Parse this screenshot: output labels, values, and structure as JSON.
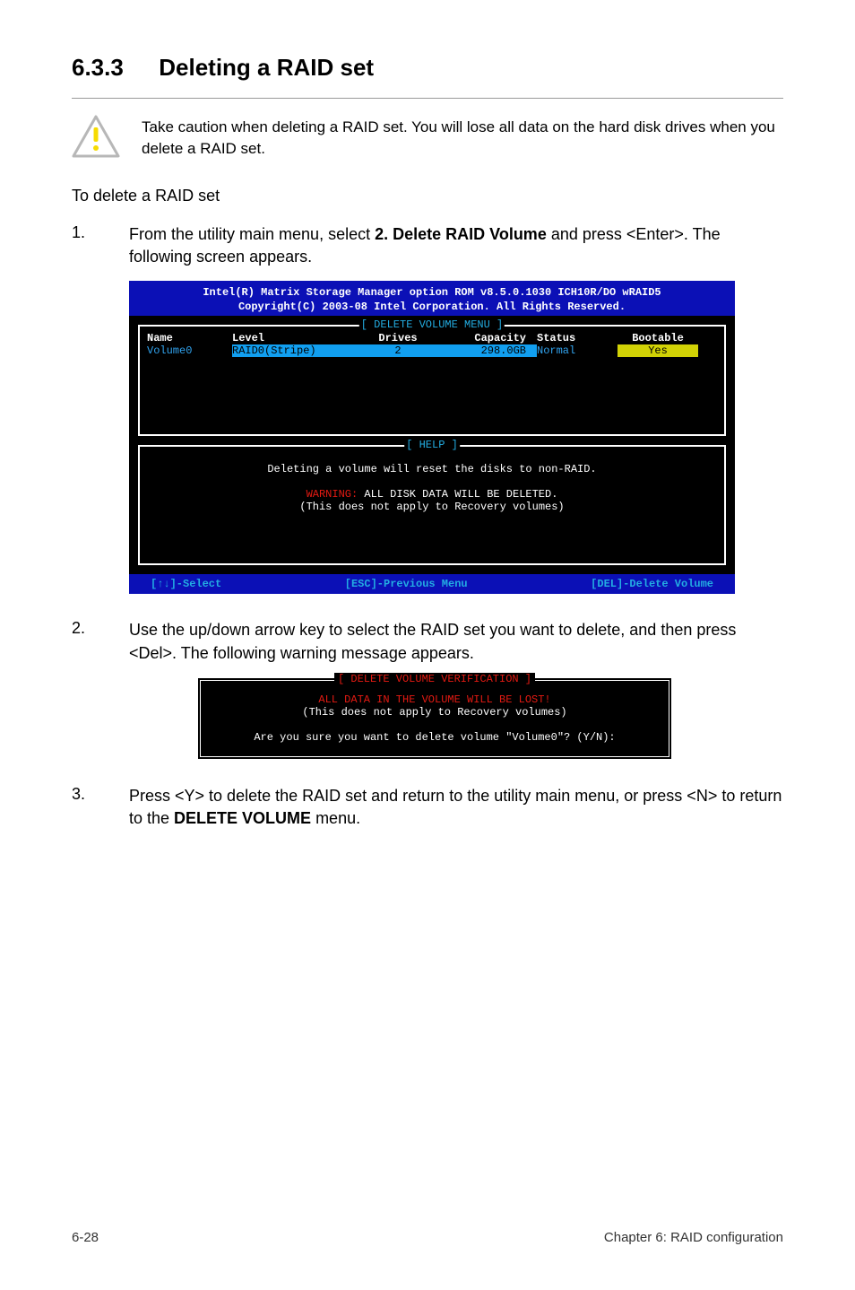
{
  "heading": {
    "number": "6.3.3",
    "title": "Deleting a RAID set"
  },
  "caution": "Take caution when deleting a RAID set. You will lose all data on the hard disk drives when you delete a RAID set.",
  "intro": "To delete a RAID set",
  "step1": {
    "num": "1.",
    "prefix": "From the utility main menu, select ",
    "bold": "2. Delete RAID Volume",
    "suffix": " and press <Enter>. The following screen appears."
  },
  "bios": {
    "header_line1": "Intel(R) Matrix Storage Manager option ROM v8.5.0.1030 ICH10R/DO wRAID5",
    "header_line2": "Copyright(C) 2003-08 Intel Corporation.  All Rights Reserved.",
    "menu_label": "[ DELETE VOLUME MENU ]",
    "columns": {
      "name": "Name",
      "level": "Level",
      "drives": "Drives",
      "capacity": "Capacity",
      "status": "Status",
      "bootable": "Bootable"
    },
    "row": {
      "name": "Volume0",
      "level": "RAID0(Stripe)",
      "drives": "2",
      "capacity": "298.0GB",
      "status": "Normal",
      "bootable": "Yes"
    },
    "help_label": "[ HELP ]",
    "help_line1": "Deleting a volume will reset the disks to non-RAID.",
    "help_warn_prefix": "WARNING:",
    "help_warn_rest": " ALL DISK DATA WILL BE DELETED.",
    "help_line3": "(This does not apply to Recovery volumes)",
    "footer": {
      "left": "[↑↓]-Select",
      "mid": "[ESC]-Previous Menu",
      "right": "[DEL]-Delete Volume"
    }
  },
  "step2": {
    "num": "2.",
    "text": "Use the up/down arrow key to select the RAID set you want to delete, and then press <Del>. The following warning message appears."
  },
  "verify": {
    "label": "[ DELETE VOLUME VERIFICATION ]",
    "line1": "ALL DATA IN THE VOLUME WILL BE LOST!",
    "line2": "(This does not apply to Recovery volumes)",
    "line3": "Are you sure you want to delete volume \"Volume0\"? (Y/N):"
  },
  "step3": {
    "num": "3.",
    "prefix": "Press <Y> to delete the RAID set and return to the utility main menu, or press <N> to return to the ",
    "bold": "DELETE VOLUME",
    "suffix": " menu."
  },
  "footer": {
    "left": "6-28",
    "right": "Chapter 6: RAID configuration"
  }
}
